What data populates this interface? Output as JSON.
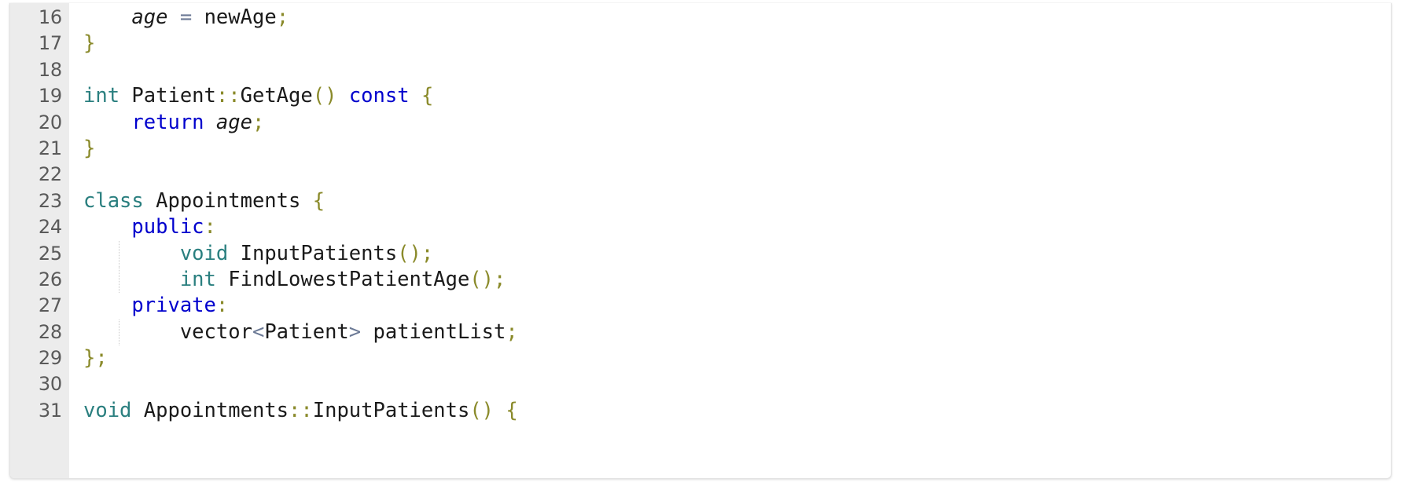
{
  "editor": {
    "language": "C++",
    "first_visible_line": 16,
    "last_visible_line": 31,
    "colors": {
      "background": "#ffffff",
      "gutter_background": "#ececec",
      "gutter_text": "#5a5a5a",
      "type_keyword": "#2a7f7f",
      "keyword": "#0000cd",
      "punctuation": "#8a8a2a",
      "operator": "#6c7a96",
      "identifier": "#1a1a1a",
      "indent_guide": "#c9c9c9"
    },
    "lines": [
      {
        "number": "16",
        "indent_guide": false,
        "tokens": [
          {
            "text": "    ",
            "cls": "t-id"
          },
          {
            "text": "age",
            "cls": "t-member"
          },
          {
            "text": " ",
            "cls": "t-id"
          },
          {
            "text": "=",
            "cls": "t-op"
          },
          {
            "text": " ",
            "cls": "t-id"
          },
          {
            "text": "newAge",
            "cls": "t-id"
          },
          {
            "text": ";",
            "cls": "t-punc"
          }
        ]
      },
      {
        "number": "17",
        "indent_guide": false,
        "tokens": [
          {
            "text": "}",
            "cls": "t-punc"
          }
        ]
      },
      {
        "number": "18",
        "indent_guide": false,
        "tokens": []
      },
      {
        "number": "19",
        "indent_guide": false,
        "tokens": [
          {
            "text": "int",
            "cls": "t-type"
          },
          {
            "text": " ",
            "cls": "t-id"
          },
          {
            "text": "Patient",
            "cls": "t-id"
          },
          {
            "text": "::",
            "cls": "t-punc"
          },
          {
            "text": "GetAge",
            "cls": "t-id"
          },
          {
            "text": "()",
            "cls": "t-punc"
          },
          {
            "text": " ",
            "cls": "t-id"
          },
          {
            "text": "const",
            "cls": "t-kw"
          },
          {
            "text": " ",
            "cls": "t-id"
          },
          {
            "text": "{",
            "cls": "t-punc"
          }
        ]
      },
      {
        "number": "20",
        "indent_guide": false,
        "tokens": [
          {
            "text": "    ",
            "cls": "t-id"
          },
          {
            "text": "return",
            "cls": "t-kw"
          },
          {
            "text": " ",
            "cls": "t-id"
          },
          {
            "text": "age",
            "cls": "t-member"
          },
          {
            "text": ";",
            "cls": "t-punc"
          }
        ]
      },
      {
        "number": "21",
        "indent_guide": false,
        "tokens": [
          {
            "text": "}",
            "cls": "t-punc"
          }
        ]
      },
      {
        "number": "22",
        "indent_guide": false,
        "tokens": []
      },
      {
        "number": "23",
        "indent_guide": false,
        "tokens": [
          {
            "text": "class",
            "cls": "t-type"
          },
          {
            "text": " ",
            "cls": "t-id"
          },
          {
            "text": "Appointments",
            "cls": "t-id"
          },
          {
            "text": " ",
            "cls": "t-id"
          },
          {
            "text": "{",
            "cls": "t-punc"
          }
        ]
      },
      {
        "number": "24",
        "indent_guide": false,
        "tokens": [
          {
            "text": "    ",
            "cls": "t-id"
          },
          {
            "text": "public",
            "cls": "t-kw"
          },
          {
            "text": ":",
            "cls": "t-punc"
          }
        ]
      },
      {
        "number": "25",
        "indent_guide": true,
        "tokens": [
          {
            "text": "        ",
            "cls": "t-id"
          },
          {
            "text": "void",
            "cls": "t-type"
          },
          {
            "text": " ",
            "cls": "t-id"
          },
          {
            "text": "InputPatients",
            "cls": "t-id"
          },
          {
            "text": "()",
            "cls": "t-punc"
          },
          {
            "text": ";",
            "cls": "t-punc"
          }
        ]
      },
      {
        "number": "26",
        "indent_guide": true,
        "tokens": [
          {
            "text": "        ",
            "cls": "t-id"
          },
          {
            "text": "int",
            "cls": "t-type"
          },
          {
            "text": " ",
            "cls": "t-id"
          },
          {
            "text": "FindLowestPatientAge",
            "cls": "t-id"
          },
          {
            "text": "()",
            "cls": "t-punc"
          },
          {
            "text": ";",
            "cls": "t-punc"
          }
        ]
      },
      {
        "number": "27",
        "indent_guide": false,
        "tokens": [
          {
            "text": "    ",
            "cls": "t-id"
          },
          {
            "text": "private",
            "cls": "t-kw"
          },
          {
            "text": ":",
            "cls": "t-punc"
          }
        ]
      },
      {
        "number": "28",
        "indent_guide": true,
        "tokens": [
          {
            "text": "        ",
            "cls": "t-id"
          },
          {
            "text": "vector",
            "cls": "t-id"
          },
          {
            "text": "<",
            "cls": "t-op"
          },
          {
            "text": "Patient",
            "cls": "t-id"
          },
          {
            "text": ">",
            "cls": "t-op"
          },
          {
            "text": " ",
            "cls": "t-id"
          },
          {
            "text": "patientList",
            "cls": "t-id"
          },
          {
            "text": ";",
            "cls": "t-punc"
          }
        ]
      },
      {
        "number": "29",
        "indent_guide": false,
        "tokens": [
          {
            "text": "}",
            "cls": "t-punc"
          },
          {
            "text": ";",
            "cls": "t-punc"
          }
        ]
      },
      {
        "number": "30",
        "indent_guide": false,
        "tokens": []
      },
      {
        "number": "31",
        "indent_guide": false,
        "tokens": [
          {
            "text": "void",
            "cls": "t-type"
          },
          {
            "text": " ",
            "cls": "t-id"
          },
          {
            "text": "Appointments",
            "cls": "t-id"
          },
          {
            "text": "::",
            "cls": "t-punc"
          },
          {
            "text": "InputPatients",
            "cls": "t-id"
          },
          {
            "text": "()",
            "cls": "t-punc"
          },
          {
            "text": " ",
            "cls": "t-id"
          },
          {
            "text": "{",
            "cls": "t-punc"
          }
        ]
      }
    ]
  }
}
